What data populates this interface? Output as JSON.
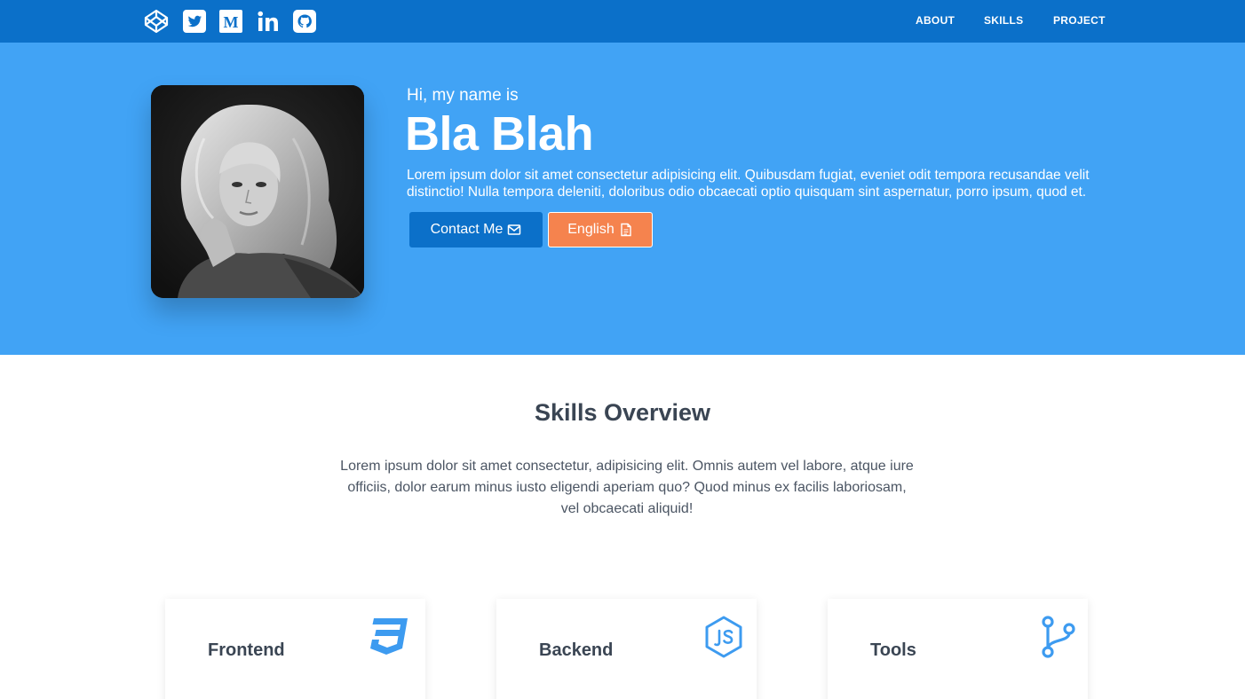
{
  "topbar": {
    "social_icons": [
      "codepen-icon",
      "twitter-icon",
      "medium-icon",
      "linkedin-icon",
      "github-icon"
    ],
    "nav": [
      "ABOUT",
      "SKILLS",
      "PROJECT"
    ]
  },
  "hero": {
    "greeting": "Hi, my name is",
    "name": "Bla Blah",
    "bio": "Lorem ipsum dolor sit amet consectetur adipisicing elit. Quibusdam fugiat, eveniet odit tempora recusandae velit distinctio! Nulla tempora deleniti, doloribus odio obcaecati optio quisquam sint aspernatur, porro ipsum, quod et.",
    "contact_label": "Contact Me",
    "cv_label": "English",
    "contact_icon": "envelope-icon",
    "cv_icon": "file-icon"
  },
  "skills": {
    "title": "Skills Overview",
    "description": "Lorem ipsum dolor sit amet consectetur, adipisicing elit. Omnis autem vel labore, atque iure officiis, dolor earum minus iusto eligendi aperiam quo? Quod minus ex facilis laboriosam, vel obcaecati aliquid!",
    "cards": [
      {
        "title": "Frontend",
        "icon": "css3-icon"
      },
      {
        "title": "Backend",
        "icon": "nodejs-icon"
      },
      {
        "title": "Tools",
        "icon": "git-branch-icon"
      }
    ]
  },
  "colors": {
    "topbar": "#0b70c9",
    "hero": "#41a3f5",
    "accent": "#f5834e",
    "icon": "#3d9bf0",
    "heading": "#3a4553"
  }
}
